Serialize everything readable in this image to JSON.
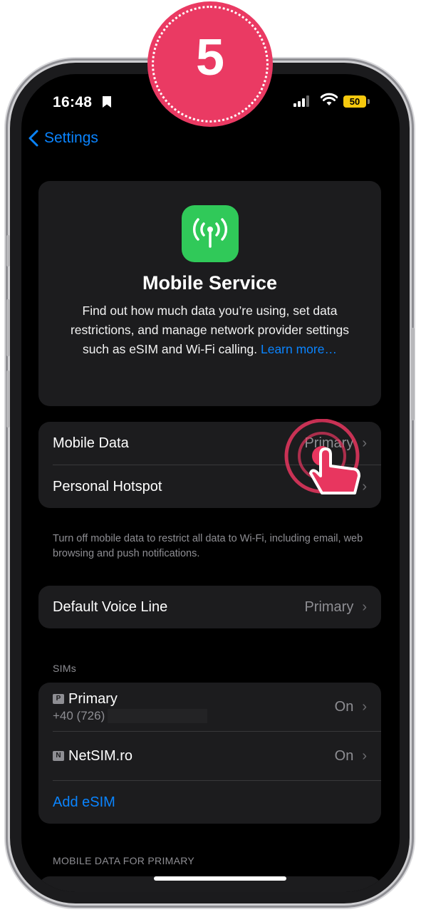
{
  "step_badge": "5",
  "status_bar": {
    "time": "16:48",
    "battery": "50"
  },
  "nav": {
    "back_label": "Settings"
  },
  "hero": {
    "title": "Mobile Service",
    "description": "Find out how much data you’re using, set data restrictions, and manage network provider settings such as eSIM and Wi-Fi calling.",
    "link": "Learn more…"
  },
  "data_group": {
    "rows": [
      {
        "label": "Mobile Data",
        "value": "Primary"
      },
      {
        "label": "Personal Hotspot",
        "value": "On"
      }
    ],
    "footnote": "Turn off mobile data to restrict all data to Wi-Fi, including email, web browsing and push notifications."
  },
  "voice_group": {
    "label": "Default Voice Line",
    "value": "Primary"
  },
  "sims": {
    "header": "SIMs",
    "items": [
      {
        "badge": "P",
        "name": "Primary",
        "number": "+40 (726)",
        "value": "On"
      },
      {
        "badge": "N",
        "name": "NetSIM.ro",
        "value": "On"
      }
    ],
    "add_label": "Add eSIM"
  },
  "mobile_data_section_header": "MOBILE DATA FOR PRIMARY",
  "colors": {
    "accent": "#0a84ff",
    "icon_green": "#30c959",
    "badge": "#ea3a63",
    "battery": "#f6c90e"
  }
}
